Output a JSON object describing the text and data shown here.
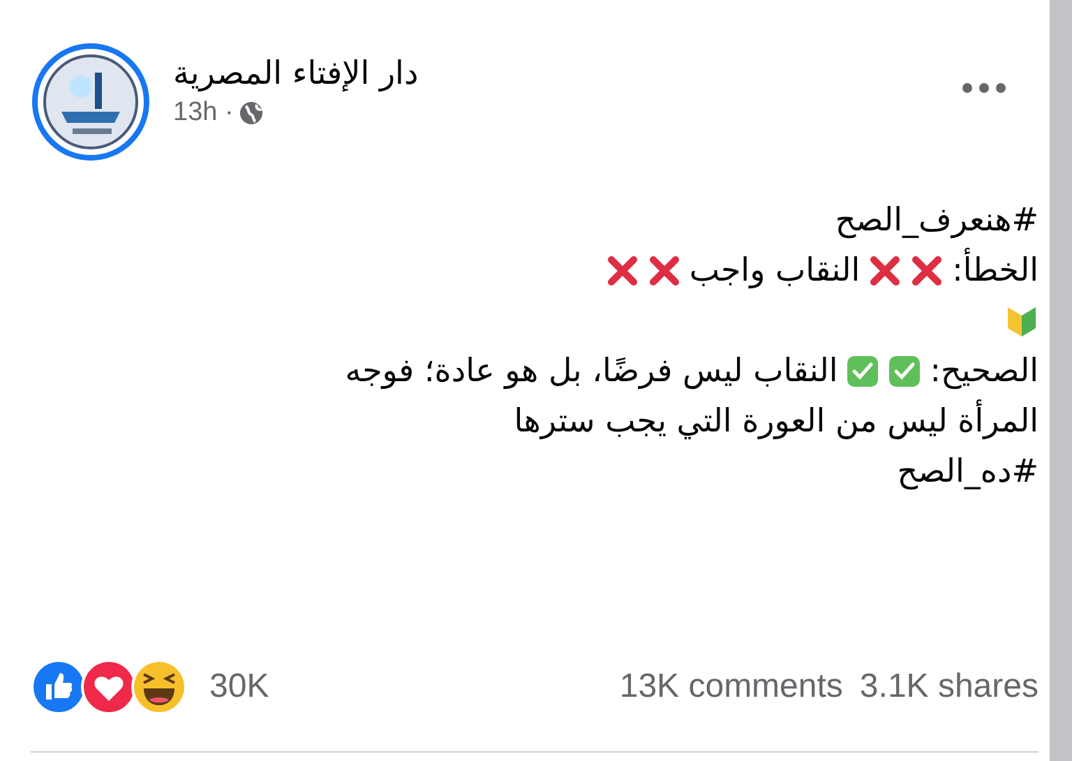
{
  "post": {
    "author": "دار الإفتاء المصرية",
    "time": "13h ·",
    "lines": [
      [
        {
          "kind": "text",
          "text": "#هنعرف_الصح"
        }
      ],
      [
        {
          "kind": "text",
          "text": "الخطأ:"
        },
        {
          "kind": "cross"
        },
        {
          "kind": "cross"
        },
        {
          "kind": "text",
          "text": "النقاب واجب"
        },
        {
          "kind": "cross"
        },
        {
          "kind": "cross"
        }
      ],
      [
        {
          "kind": "leaf"
        }
      ],
      [
        {
          "kind": "text",
          "text": "الصحيح:"
        },
        {
          "kind": "check"
        },
        {
          "kind": "check"
        },
        {
          "kind": "text",
          "text": "النقاب ليس فرضًا، بل هو عادة؛ فوجه"
        }
      ],
      [
        {
          "kind": "text",
          "text": "المرأة ليس من العورة التي يجب سترها"
        }
      ],
      [
        {
          "kind": "text",
          "text": "#ده_الصح"
        }
      ]
    ],
    "reactions": {
      "count": "30K",
      "comments": "13K comments",
      "shares": "3.1K shares"
    }
  }
}
